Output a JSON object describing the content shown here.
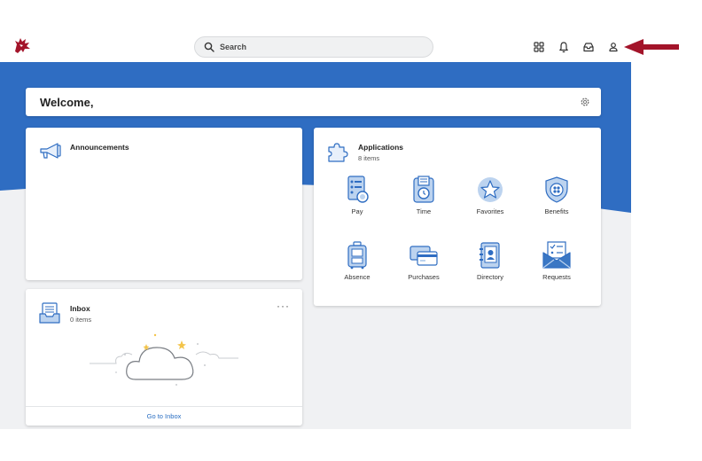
{
  "header": {
    "search_placeholder": "Search",
    "icons": [
      "apps-grid-icon",
      "bell-icon",
      "inbox-tray-icon",
      "profile-icon"
    ],
    "accent_arrow_color": "#a3142a"
  },
  "welcome": {
    "title": "Welcome,"
  },
  "announcements": {
    "title": "Announcements"
  },
  "applications": {
    "title": "Applications",
    "count": "8 items",
    "items": [
      {
        "label": "Pay",
        "icon": "pay-icon"
      },
      {
        "label": "Time",
        "icon": "time-icon"
      },
      {
        "label": "Favorites",
        "icon": "star-icon"
      },
      {
        "label": "Benefits",
        "icon": "shield-icon"
      },
      {
        "label": "Absence",
        "icon": "luggage-icon"
      },
      {
        "label": "Purchases",
        "icon": "credit-card-icon"
      },
      {
        "label": "Directory",
        "icon": "address-book-icon"
      },
      {
        "label": "Requests",
        "icon": "envelope-icon"
      }
    ]
  },
  "inbox": {
    "title": "Inbox",
    "count": "0 items",
    "menu": "···",
    "link": "Go to Inbox"
  },
  "colors": {
    "brand_blue": "#2f6dc2",
    "icon_blue": "#3a77c4",
    "light_blue": "#bcd3ef",
    "page_bg": "#f0f1f3"
  }
}
